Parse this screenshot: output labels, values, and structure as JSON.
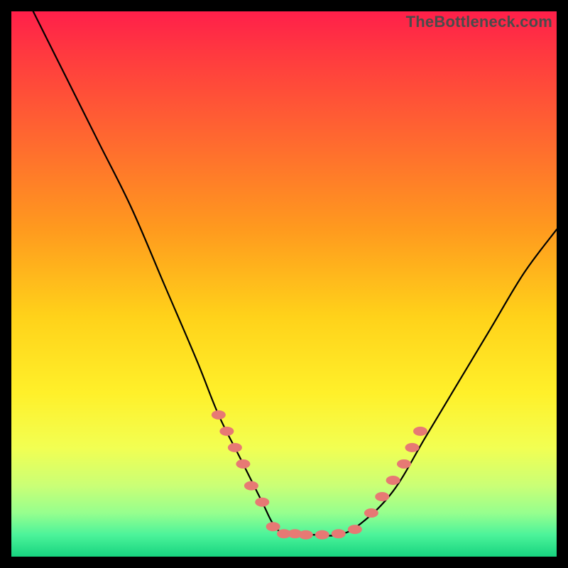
{
  "watermark": "TheBottleneck.com",
  "colors": {
    "marker": "#e77974",
    "curve": "#000000"
  },
  "chart_data": {
    "type": "line",
    "title": "",
    "xlabel": "",
    "ylabel": "",
    "xlim": [
      0,
      100
    ],
    "ylim": [
      0,
      100
    ],
    "grid": false,
    "note": "No axes, ticks, or numeric labels are rendered in the image. x/y are normalized 0–100 estimates read from pixel position. y=100 is top (red), y=0 is bottom (green). Curve is an asymmetric V with flat bottom.",
    "series": [
      {
        "name": "bottleneck-curve",
        "x": [
          4,
          10,
          16,
          22,
          28,
          34,
          38,
          42,
          46,
          48,
          50,
          52,
          56,
          60,
          64,
          70,
          76,
          82,
          88,
          94,
          100
        ],
        "y": [
          100,
          88,
          76,
          64,
          50,
          36,
          26,
          18,
          10,
          6,
          4,
          4,
          4,
          4,
          6,
          12,
          22,
          32,
          42,
          52,
          60
        ]
      }
    ],
    "markers": {
      "name": "highlight-dots",
      "note": "Salmon dots clustered along lower arms and flat trough of the curve.",
      "points": [
        {
          "x": 38,
          "y": 26
        },
        {
          "x": 39.5,
          "y": 23
        },
        {
          "x": 41,
          "y": 20
        },
        {
          "x": 42.5,
          "y": 17
        },
        {
          "x": 44,
          "y": 13
        },
        {
          "x": 46,
          "y": 10
        },
        {
          "x": 48,
          "y": 5.5
        },
        {
          "x": 50,
          "y": 4.2
        },
        {
          "x": 52,
          "y": 4.2
        },
        {
          "x": 54,
          "y": 4
        },
        {
          "x": 57,
          "y": 4
        },
        {
          "x": 60,
          "y": 4.2
        },
        {
          "x": 63,
          "y": 5
        },
        {
          "x": 66,
          "y": 8
        },
        {
          "x": 68,
          "y": 11
        },
        {
          "x": 70,
          "y": 14
        },
        {
          "x": 72,
          "y": 17
        },
        {
          "x": 73.5,
          "y": 20
        },
        {
          "x": 75,
          "y": 23
        }
      ]
    }
  }
}
